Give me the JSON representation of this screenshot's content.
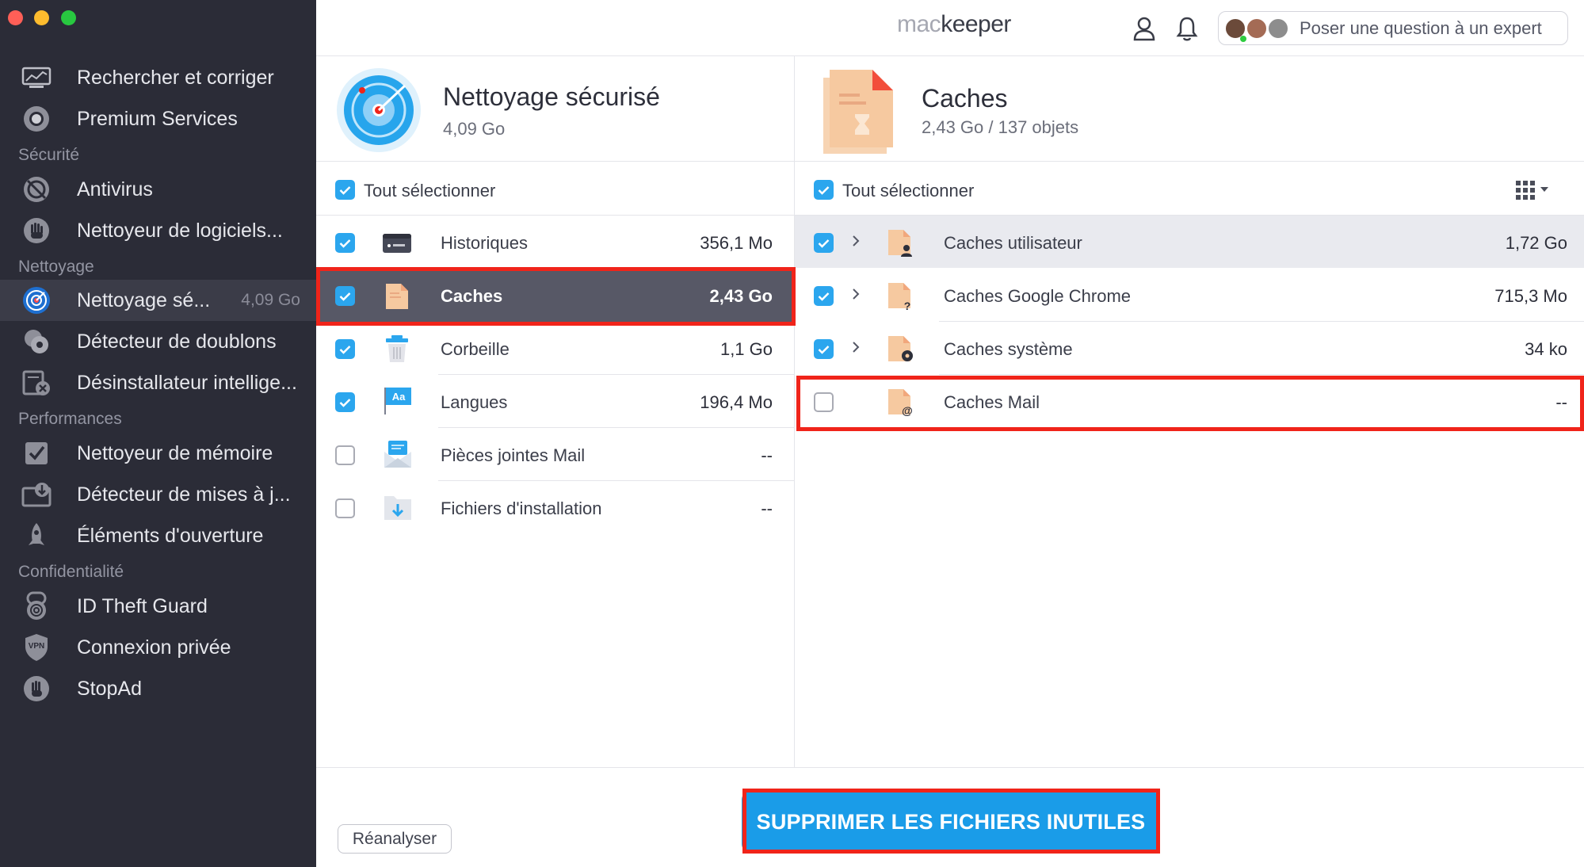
{
  "colors": {
    "accent": "#2ba6ee",
    "sidebar_bg": "#2b2c37",
    "highlight": "#f0241a",
    "selected_row": "#575866"
  },
  "header": {
    "logo_a": "mac",
    "logo_b": "keeper",
    "expert_label": "Poser une question à un expert"
  },
  "sidebar": {
    "items": [
      {
        "label": "Rechercher et corriger",
        "icon": "monitor-icon"
      },
      {
        "label": "Premium Services",
        "icon": "support-icon"
      },
      {
        "label": "Antivirus",
        "icon": "antivirus-icon"
      },
      {
        "label": "Nettoyeur de logiciels...",
        "icon": "hand-stop-icon"
      },
      {
        "label": "Nettoyage sé...",
        "value": "4,09 Go",
        "icon": "radar-icon",
        "active": true
      },
      {
        "label": "Détecteur de doublons",
        "icon": "duplicates-icon"
      },
      {
        "label": "Désinstallateur intellige...",
        "icon": "uninstaller-icon"
      },
      {
        "label": "Nettoyeur de mémoire",
        "icon": "memory-icon"
      },
      {
        "label": "Détecteur de mises à j...",
        "icon": "update-icon"
      },
      {
        "label": "Éléments d'ouverture",
        "icon": "rocket-icon"
      },
      {
        "label": "ID Theft Guard",
        "icon": "fingerprint-icon"
      },
      {
        "label": "Connexion privée",
        "icon": "vpn-icon"
      },
      {
        "label": "StopAd",
        "icon": "stopad-hand-icon"
      }
    ],
    "sections": [
      "Sécurité",
      "Nettoyage",
      "Performances",
      "Confidentialité"
    ]
  },
  "left_panel": {
    "title": "Nettoyage sécurisé",
    "size": "4,09 Go",
    "select_all": "Tout sélectionner",
    "rows": [
      {
        "label": "Historiques",
        "value": "356,1 Mo",
        "checked": true,
        "icon": "history-icon"
      },
      {
        "label": "Caches",
        "value": "2,43 Go",
        "checked": true,
        "icon": "cache-file-icon",
        "selected": true
      },
      {
        "label": "Corbeille",
        "value": "1,1 Go",
        "checked": true,
        "icon": "trash-icon"
      },
      {
        "label": "Langues",
        "value": "196,4 Mo",
        "checked": true,
        "icon": "languages-icon"
      },
      {
        "label": "Pièces jointes Mail",
        "value": "--",
        "checked": false,
        "icon": "mail-attachment-icon"
      },
      {
        "label": "Fichiers d'installation",
        "value": "--",
        "checked": false,
        "icon": "installer-folder-icon"
      }
    ]
  },
  "right_panel": {
    "title": "Caches",
    "subtitle": "2,43 Go / 137 objets",
    "select_all": "Tout sélectionner",
    "rows": [
      {
        "label": "Caches utilisateur",
        "value": "1,72 Go",
        "checked": true,
        "expandable": true,
        "icon": "user-cache-icon"
      },
      {
        "label": "Caches Google Chrome",
        "value": "715,3 Mo",
        "checked": true,
        "expandable": true,
        "icon": "chrome-cache-icon"
      },
      {
        "label": "Caches système",
        "value": "34 ko",
        "checked": true,
        "expandable": true,
        "icon": "system-cache-icon"
      },
      {
        "label": "Caches Mail",
        "value": "--",
        "checked": false,
        "expandable": false,
        "icon": "mail-cache-icon"
      }
    ]
  },
  "footer": {
    "delete_label": "SUPPRIMER LES FICHIERS INUTILES",
    "rescan_label": "Réanalyser"
  }
}
